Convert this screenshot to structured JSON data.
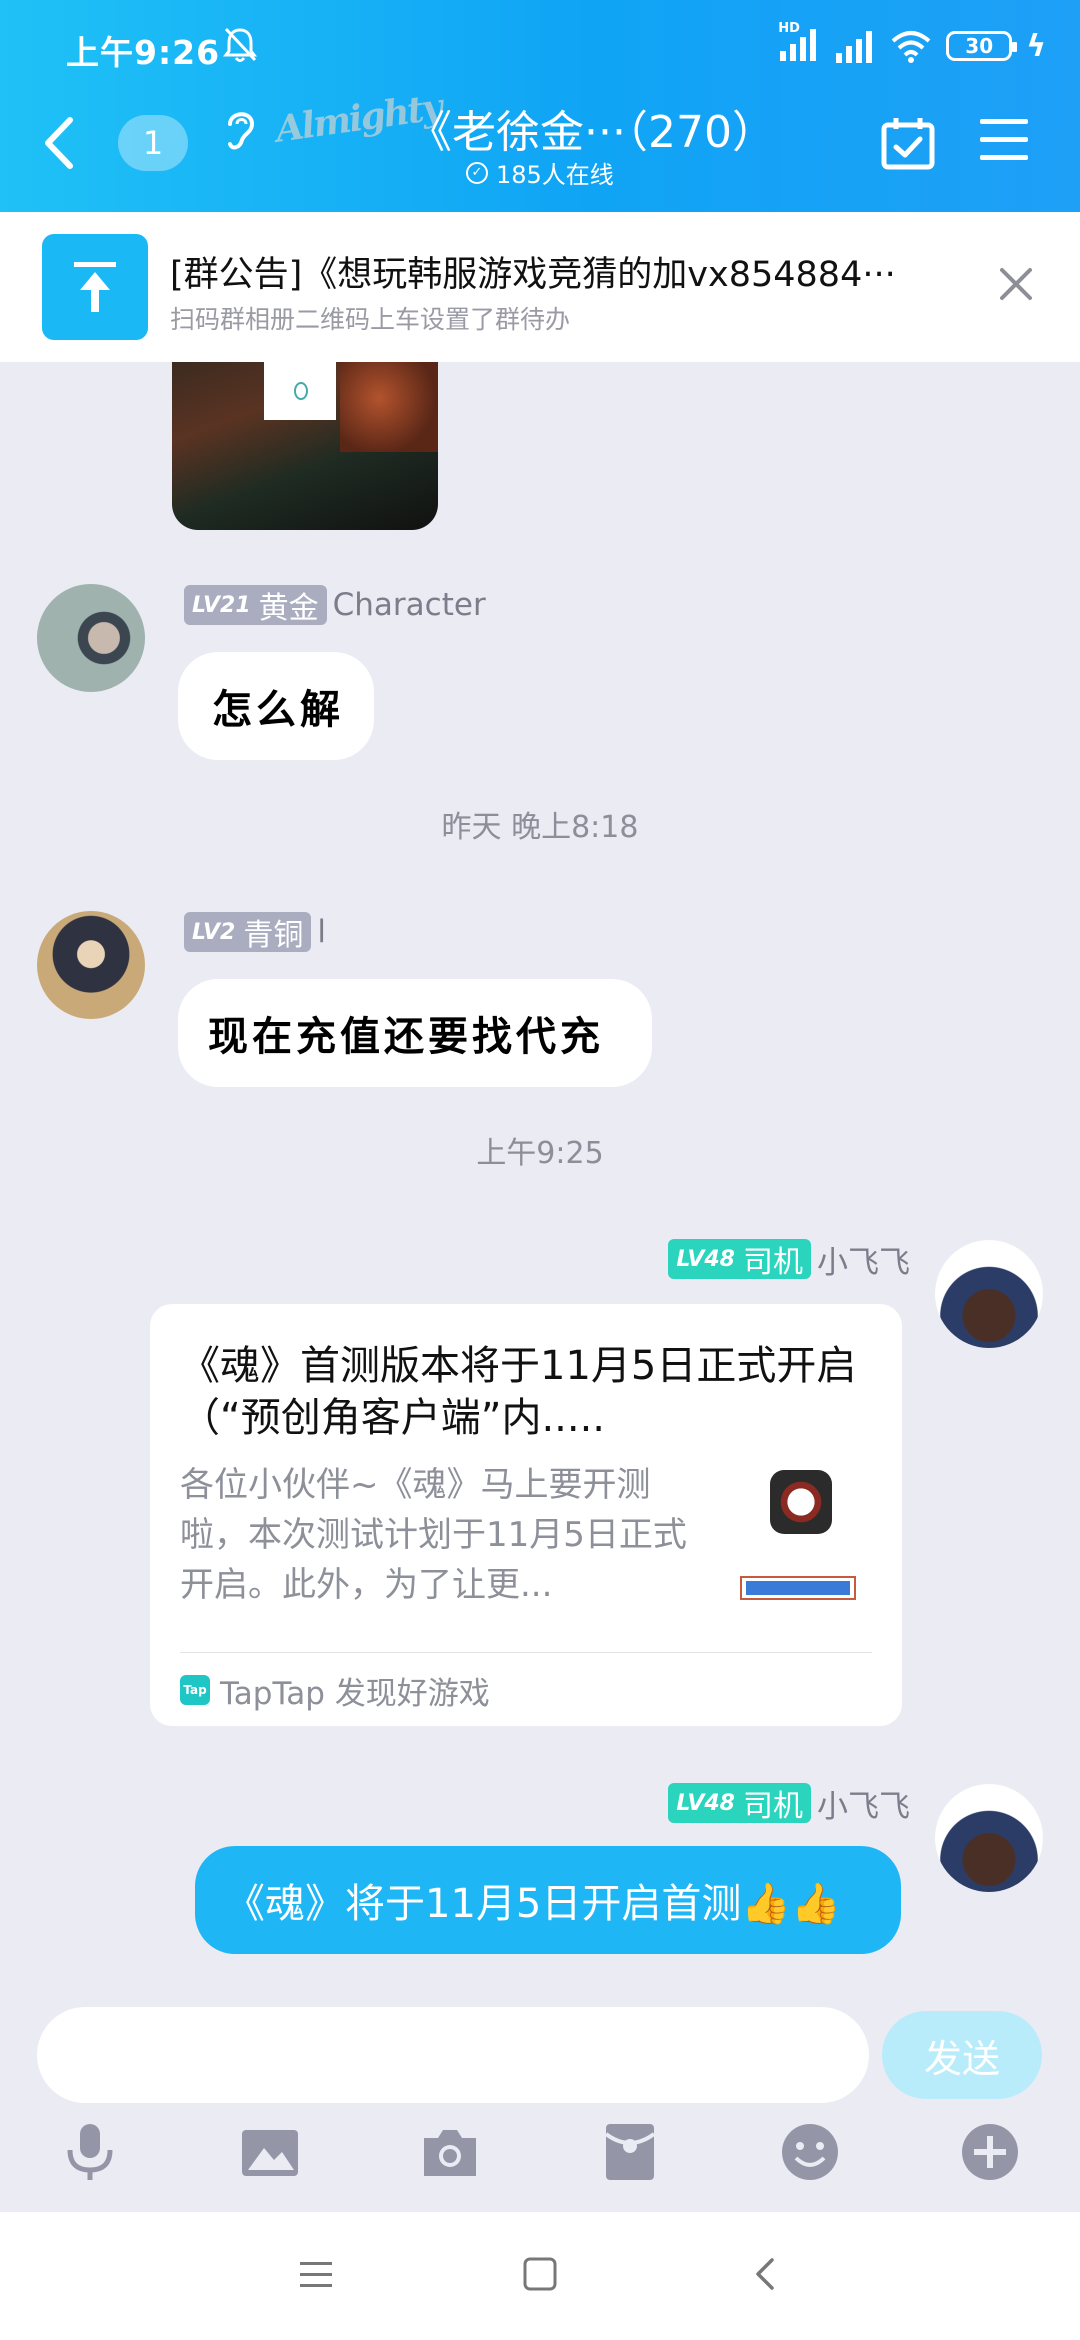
{
  "status_bar": {
    "time": "上午9:26",
    "battery": "30",
    "hd_label": "HD"
  },
  "header": {
    "back_badge": "1",
    "title": "《老徐金···（270）",
    "online": "185人在线",
    "accent_color": "#10a4f5"
  },
  "notice": {
    "title": "[群公告]《想玩韩服游戏竞猜的加vx854884···",
    "subtitle": "扫码群相册二维码上车设置了群待办"
  },
  "messages": {
    "msg1": {
      "level": "LV21",
      "title": "黄金",
      "nick": "Character",
      "text": "怎么解"
    },
    "time1": "昨天 晚上8:18",
    "msg2": {
      "level": "LV2",
      "title": "青铜",
      "nick": "l",
      "text": "现在充值还要找代充"
    },
    "time2": "上午9:25",
    "msg3": {
      "level": "LV48",
      "title": "司机",
      "nick": "小飞飞",
      "card_title": "《魂》首测版本将于11月5日正式开启（“预创角客户端”内.....",
      "card_desc": "各位小伙伴~《魂》马上要开测啦，本次测试计划于11月5日正式开启。此外，为了让更...",
      "card_source": "TapTap 发现好游戏",
      "tap_icon": "Tap"
    },
    "msg4": {
      "level": "LV48",
      "title": "司机",
      "nick": "小飞飞",
      "text": "《魂》将于11月5日开启首测👍👍"
    }
  },
  "input": {
    "value": "",
    "send_label": "发送"
  },
  "icons": {
    "toolbar": [
      "microphone-icon",
      "image-icon",
      "camera-icon",
      "red-packet-icon",
      "emoji-icon",
      "plus-icon"
    ],
    "system_nav": [
      "menu-icon",
      "home-icon",
      "back-icon"
    ]
  }
}
